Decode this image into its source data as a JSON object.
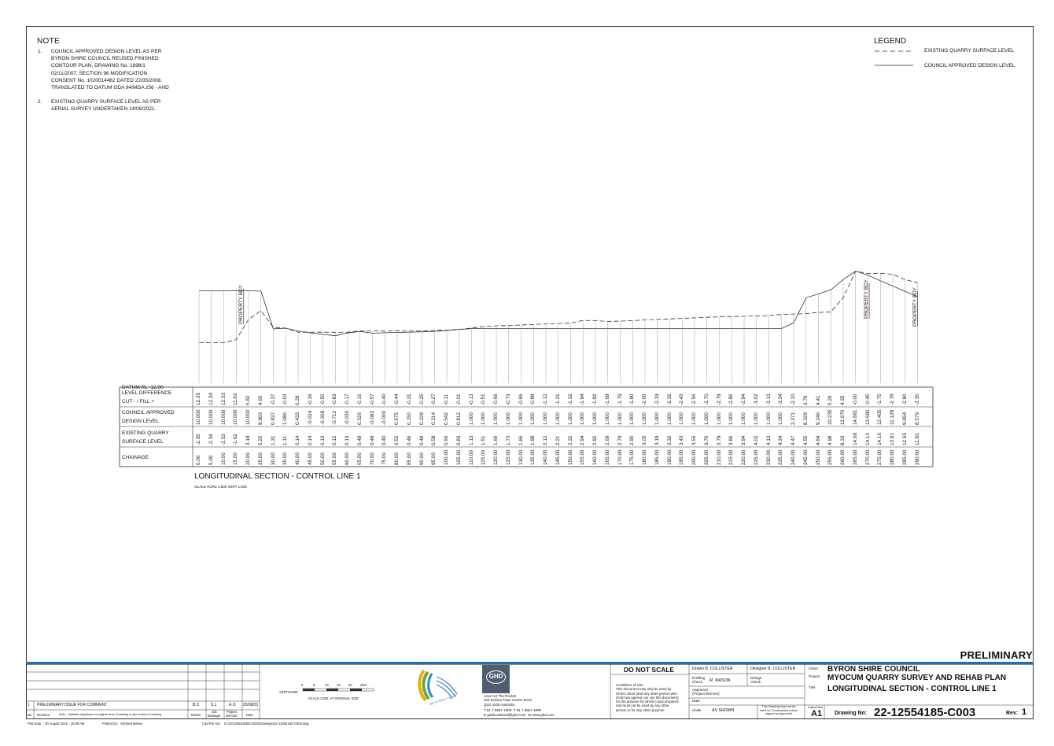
{
  "notes": {
    "title": "NOTE",
    "items": [
      {
        "num": "1.",
        "text": "COUNCIL APPROVED DESIGN LEVEL AS PER\nBYRON SHIRE COUNCIL REUSED FINISHED\nCONTOUR PLAN, DRAWING No. 1898/1\n02/11/2007. SECTION 96 MODIFICATION\nCONSENT No. 1020014462 DATED 22/05/2008.\nTRANSLATED TO DATUM GDA 94/MGA z56 - AHD"
      },
      {
        "num": "2.",
        "text": "EXISTING QUARRY SURFACE LEVEL AS PER\nAERIAL SURVEY UNDERTAKEN 14/06/2021."
      }
    ]
  },
  "legend": {
    "title": "LEGEND",
    "items": [
      {
        "style": "dashed",
        "label": "EXISTING QUARRY SURFACE LEVEL"
      },
      {
        "style": "solid",
        "label": "COUNCIL APPROVED DESIGN LEVEL"
      }
    ]
  },
  "section": {
    "datum": "DATUM RL -12.00",
    "property_boundary_label": "PROPERTY BDY",
    "row_labels": [
      "LEVEL DIFFERENCE\nCUT - / FILL +",
      "COUNCIL APPROVED\nDESIGN LEVEL",
      "EXISTING QUARRY\nSURFACE LEVEL",
      "CHAINAGE"
    ],
    "chainage": [
      "0.00",
      "5.00",
      "10.00",
      "15.00",
      "20.00",
      "25.00",
      "30.00",
      "35.00",
      "40.00",
      "45.00",
      "50.00",
      "55.00",
      "60.00",
      "65.00",
      "70.00",
      "75.00",
      "80.00",
      "85.00",
      "90.00",
      "95.00",
      "100.00",
      "105.00",
      "110.00",
      "115.00",
      "120.00",
      "125.00",
      "130.00",
      "135.00",
      "140.00",
      "145.00",
      "150.00",
      "155.00",
      "160.00",
      "165.00",
      "170.00",
      "175.00",
      "180.00",
      "185.00",
      "190.00",
      "195.00",
      "200.00",
      "205.00",
      "210.00",
      "215.00",
      "220.00",
      "225.00",
      "230.00",
      "235.00",
      "240.00",
      "245.00",
      "250.00",
      "255.00",
      "260.00",
      "265.00",
      "270.00",
      "275.00",
      "280.00",
      "285.00",
      "290.00"
    ],
    "existing": [
      "-2.35",
      "-2.34",
      "-2.33",
      "-1.62",
      "3.18",
      "5.25",
      "1.31",
      "1.11",
      "0.14",
      "0.14",
      "0.13",
      "0.12",
      "0.13",
      "0.48",
      "0.48",
      "0.40",
      "0.52",
      "0.46",
      "0.48",
      "0.58",
      "0.66",
      "0.83",
      "1.13",
      "1.51",
      "1.66",
      "1.73",
      "1.86",
      "1.98",
      "2.12",
      "2.21",
      "2.32",
      "2.94",
      "2.92",
      "2.69",
      "2.79",
      "2.90",
      "3.05",
      "3.19",
      "3.32",
      "3.43",
      "3.56",
      "3.70",
      "3.79",
      "3.86",
      "3.94",
      "4.02",
      "4.13",
      "4.34",
      "4.47",
      "4.55",
      "4.84",
      "4.98",
      "8.33",
      "14.68",
      "14.13",
      "14.16",
      "13.91",
      "12.65",
      "11.93"
    ],
    "design": [
      "10.000",
      "10.000",
      "10.000",
      "10.000",
      "10.000",
      "9.903",
      "0.937",
      "1.086",
      "0.433",
      "-0.024",
      "-0.368",
      "-0.712",
      "-0.036",
      "0.326",
      "-0.082",
      "-0.000",
      "0.075",
      "0.150",
      "0.229",
      "0.314",
      "0.542",
      "0.812",
      "1.000",
      "1.000",
      "1.000",
      "1.000",
      "1.000",
      "1.000",
      "1.000",
      "1.000",
      "1.000",
      "1.000",
      "1.000",
      "1.000",
      "1.000",
      "1.000",
      "1.000",
      "1.000",
      "1.000",
      "1.000",
      "1.000",
      "1.000",
      "1.000",
      "1.000",
      "1.000",
      "1.000",
      "1.000",
      "1.000",
      "2.371",
      "8.329",
      "9.246",
      "10.235",
      "12.676",
      "14.681",
      "13.680",
      "12.405",
      "11.129",
      "9.854",
      "8.579"
    ],
    "difference": [
      "12.35",
      "12.34",
      "12.33",
      "11.62",
      "6.82",
      "4.65",
      "-0.37",
      "-0.03",
      "0.29",
      "-0.16",
      "-0.50",
      "-0.83",
      "-0.17",
      "-0.16",
      "-0.57",
      "-0.40",
      "-0.44",
      "-0.31",
      "-0.25",
      "-0.27",
      "-0.11",
      "-0.01",
      "-0.13",
      "-0.51",
      "-0.66",
      "-0.73",
      "-0.86",
      "-0.98",
      "-1.12",
      "-1.21",
      "-1.32",
      "-1.94",
      "-1.92",
      "-1.69",
      "-1.79",
      "-1.90",
      "-2.05",
      "-2.19",
      "-2.32",
      "-2.43",
      "-2.56",
      "-2.70",
      "-2.79",
      "-2.86",
      "-2.94",
      "-3.02",
      "-3.13",
      "-3.34",
      "-2.10",
      "3.78",
      "4.41",
      "5.26",
      "4.35",
      "-0.00",
      "-0.45",
      "-1.75",
      "-2.78",
      "-2.80",
      "-3.35"
    ],
    "title": "LONGITUDINAL SECTION - CONTROL LINE 1",
    "scale": "SCALE HORZ 1:500   VERT 1:500"
  },
  "titleblock": {
    "preliminary": "PRELIMINARY",
    "revision": {
      "no": "1",
      "desc": "PRELIMINARY ISSUE FOR COMMENT",
      "drawn": "B.C",
      "job_manager": "S.L",
      "project_director": "A.O",
      "date": "20/08/21"
    },
    "rev_header": {
      "no": "No",
      "revision": "Revision",
      "note": "Note: * indicates signatures on original issue of drawing or last revision of drawing",
      "drawn": "Drawn",
      "job_manager": "Job\nManager",
      "project_director": "Project\nDirector",
      "date": "Date"
    },
    "scalebar": {
      "label": "VERT/HORZ",
      "ticks": [
        "0",
        "5",
        "10",
        "15",
        "20",
        "25m"
      ],
      "caption": "SCALE 1:500  AT ORIGINAL SIZE"
    },
    "council_logo_text": "Byron Shire Council",
    "ghd": {
      "logo": "GHD",
      "address": "Level 13 The Rocket\n203 Robina Town Centre Drive\nQLD 4226 Australia",
      "phone_line": "T 61 7 5557 1000  F 61 7 5557 1099",
      "email_line": "E goldcoastmail@ghd.com  W www.ghd.com"
    },
    "do_not_scale": "DO NOT SCALE",
    "conditions": "Conditions of Use.\nThis document may only be used by\nGHD's client (and any other person who\nGHD has agreed can use this document)\nfor the purpose for which it was prepared\nand must not be used by any other\nperson or for any other purpose.",
    "drawn": "Drawn   B. COLLISTER",
    "designer": "Designer  B. COLLISTER",
    "drafting_check": "Drafting\nCheck",
    "drafting_check_name": "M. MASON",
    "design_check": "Design\nCheck",
    "approved": "Approved\n(Project Director)",
    "date_label": "Date",
    "scale_label": "Scale",
    "scale_value": "AS SHOWN",
    "construction_note": "This Drawing must not be\nused for Construction unless\nsigned as Approved",
    "client_label": "Client",
    "client": "BYRON SHIRE COUNCIL",
    "project_label": "Project",
    "project": "MYOCUM QUARRY SURVEY AND REHAB PLAN",
    "title_label": "Title",
    "title": "LONGITUDINAL SECTION - CONTROL LINE 1",
    "original_size_label": "Original Size",
    "sheet": "A1",
    "drawing_no_label": "Drawing No:",
    "drawing_no": "22-12554185-C003",
    "rev_label": "Rev:",
    "rev": "1"
  },
  "footer": {
    "plot_date": "Plot Date :  20 August 2021 - 10:09 AM",
    "plotted_by": "Plotted by:   Michael Mason",
    "cad_file": "Cad File No:    G:\\22\\12554185\\CADD\\Drawings\\22-12554185-C003.dwg"
  },
  "colors": {
    "accent": "#1e6fae",
    "property_line": "#cc2222",
    "line": "#333333"
  }
}
